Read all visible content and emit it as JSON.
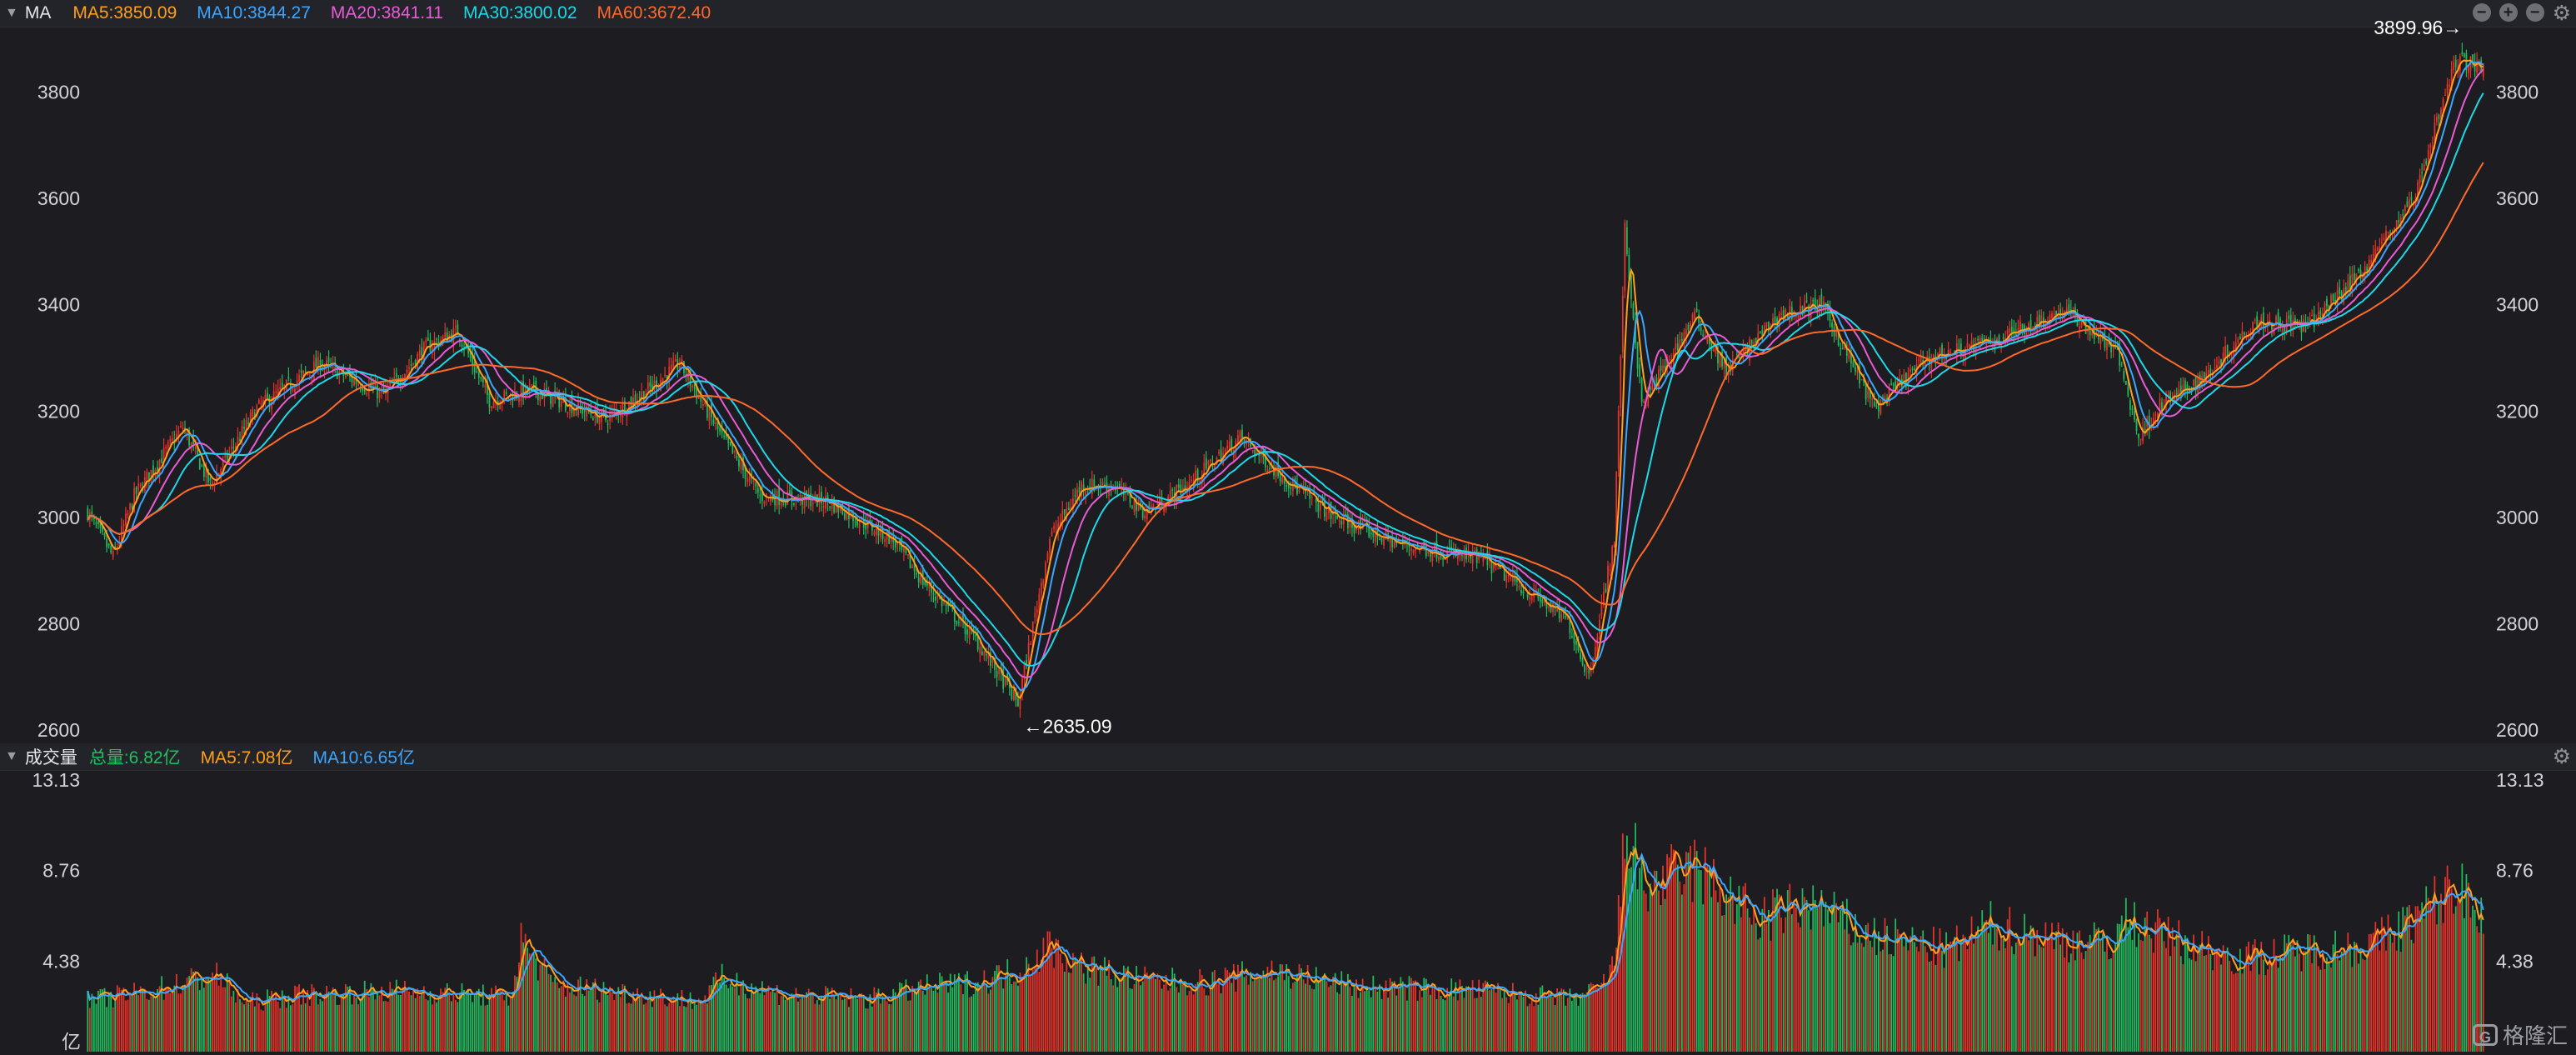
{
  "price_header": {
    "indicator_name": "MA",
    "legend": [
      {
        "label": "MA5:3850.09",
        "color": "#ff9f1c"
      },
      {
        "label": "MA10:3844.27",
        "color": "#3ba6ff"
      },
      {
        "label": "MA20:3841.11",
        "color": "#e85cd3"
      },
      {
        "label": "MA30:3800.02",
        "color": "#1ed8e8"
      },
      {
        "label": "MA60:3672.40",
        "color": "#ff6a2a"
      }
    ],
    "controls": [
      "minus-circle-icon",
      "plus-circle-icon",
      "minus-circle-icon",
      "gear-icon"
    ]
  },
  "volume_header": {
    "indicator_name": "成交量",
    "legend": [
      {
        "label": "总量:6.82亿",
        "color": "#20c060"
      },
      {
        "label": "MA5:7.08亿",
        "color": "#ff9f1c"
      },
      {
        "label": "MA10:6.65亿",
        "color": "#3ba6ff"
      }
    ]
  },
  "watermark": {
    "logo": "G",
    "text": "格隆汇"
  },
  "chart_data": [
    {
      "type": "candlestick",
      "y_ticks": [
        "3800",
        "3600",
        "3400",
        "3200",
        "3000",
        "2800",
        "2600"
      ],
      "ylim": [
        2600,
        3920
      ],
      "grid": false,
      "annotations": [
        {
          "label": "3899.96→",
          "value": 3899.96,
          "kind": "high"
        },
        {
          "label": "←2635.09",
          "value": 2635.09,
          "kind": "low"
        }
      ],
      "colors": {
        "up": "#e5332a",
        "down": "#1fbb5c"
      },
      "path_keypoints": [
        [
          0,
          3010
        ],
        [
          12,
          2925
        ],
        [
          22,
          3040
        ],
        [
          45,
          3170
        ],
        [
          58,
          3060
        ],
        [
          80,
          3205
        ],
        [
          110,
          3290
        ],
        [
          140,
          3230
        ],
        [
          160,
          3320
        ],
        [
          175,
          3350
        ],
        [
          190,
          3220
        ],
        [
          210,
          3240
        ],
        [
          245,
          3185
        ],
        [
          265,
          3240
        ],
        [
          280,
          3290
        ],
        [
          300,
          3150
        ],
        [
          318,
          3040
        ],
        [
          350,
          3030
        ],
        [
          380,
          2960
        ],
        [
          395,
          2880
        ],
        [
          420,
          2770
        ],
        [
          440,
          2650
        ],
        [
          455,
          2960
        ],
        [
          470,
          3060
        ],
        [
          485,
          3060
        ],
        [
          500,
          3010
        ],
        [
          520,
          3060
        ],
        [
          545,
          3150
        ],
        [
          570,
          3060
        ],
        [
          590,
          3000
        ],
        [
          620,
          2950
        ],
        [
          660,
          2920
        ],
        [
          685,
          2850
        ],
        [
          700,
          2805
        ],
        [
          710,
          2700
        ],
        [
          722,
          2960
        ],
        [
          727,
          3540
        ],
        [
          735,
          3210
        ],
        [
          760,
          3380
        ],
        [
          775,
          3275
        ],
        [
          800,
          3380
        ],
        [
          820,
          3400
        ],
        [
          845,
          3205
        ],
        [
          870,
          3300
        ],
        [
          900,
          3330
        ],
        [
          935,
          3390
        ],
        [
          960,
          3310
        ],
        [
          970,
          3150
        ],
        [
          980,
          3210
        ],
        [
          1000,
          3260
        ],
        [
          1025,
          3370
        ],
        [
          1050,
          3360
        ],
        [
          1075,
          3460
        ],
        [
          1100,
          3600
        ],
        [
          1120,
          3860
        ],
        [
          1133,
          3850
        ]
      ],
      "moving_averages": [
        {
          "name": "MA5",
          "color": "#ff9f1c",
          "period": 5
        },
        {
          "name": "MA10",
          "color": "#3ba6ff",
          "period": 10
        },
        {
          "name": "MA20",
          "color": "#e85cd3",
          "period": 20
        },
        {
          "name": "MA30",
          "color": "#1ed8e8",
          "period": 30
        },
        {
          "name": "MA60",
          "color": "#ff6a2a",
          "period": 60
        }
      ]
    },
    {
      "type": "bar",
      "title": "成交量",
      "y_ticks": [
        "13.13",
        "8.76",
        "4.38"
      ],
      "unit_label": "亿",
      "ylim": [
        0,
        13.13
      ],
      "colors": {
        "up": "#e5332a",
        "down": "#1fbb5c"
      },
      "volume_keypoints": [
        [
          0,
          2.5
        ],
        [
          30,
          3
        ],
        [
          60,
          3.8
        ],
        [
          75,
          2.4
        ],
        [
          100,
          2.8
        ],
        [
          150,
          3.0
        ],
        [
          200,
          2.7
        ],
        [
          205,
          5.5
        ],
        [
          220,
          3.3
        ],
        [
          290,
          2.5
        ],
        [
          300,
          3.6
        ],
        [
          330,
          2.8
        ],
        [
          370,
          2.6
        ],
        [
          398,
          3.2
        ],
        [
          420,
          3.4
        ],
        [
          440,
          4.0
        ],
        [
          455,
          5.2
        ],
        [
          470,
          4.2
        ],
        [
          500,
          3.5
        ],
        [
          530,
          3.4
        ],
        [
          560,
          4.0
        ],
        [
          600,
          3.2
        ],
        [
          660,
          3.0
        ],
        [
          700,
          2.6
        ],
        [
          715,
          3.0
        ],
        [
          722,
          4.3
        ],
        [
          728,
          11.5
        ],
        [
          735,
          8.0
        ],
        [
          760,
          9.0
        ],
        [
          790,
          6.5
        ],
        [
          815,
          7.3
        ],
        [
          840,
          5.8
        ],
        [
          860,
          5.4
        ],
        [
          880,
          5.0
        ],
        [
          900,
          6.2
        ],
        [
          930,
          5.6
        ],
        [
          955,
          5.3
        ],
        [
          965,
          6.5
        ],
        [
          985,
          5.6
        ],
        [
          1000,
          5.1
        ],
        [
          1020,
          4.6
        ],
        [
          1050,
          5.0
        ],
        [
          1080,
          5.3
        ],
        [
          1100,
          6.5
        ],
        [
          1120,
          8.2
        ],
        [
          1133,
          7.0
        ]
      ]
    }
  ]
}
